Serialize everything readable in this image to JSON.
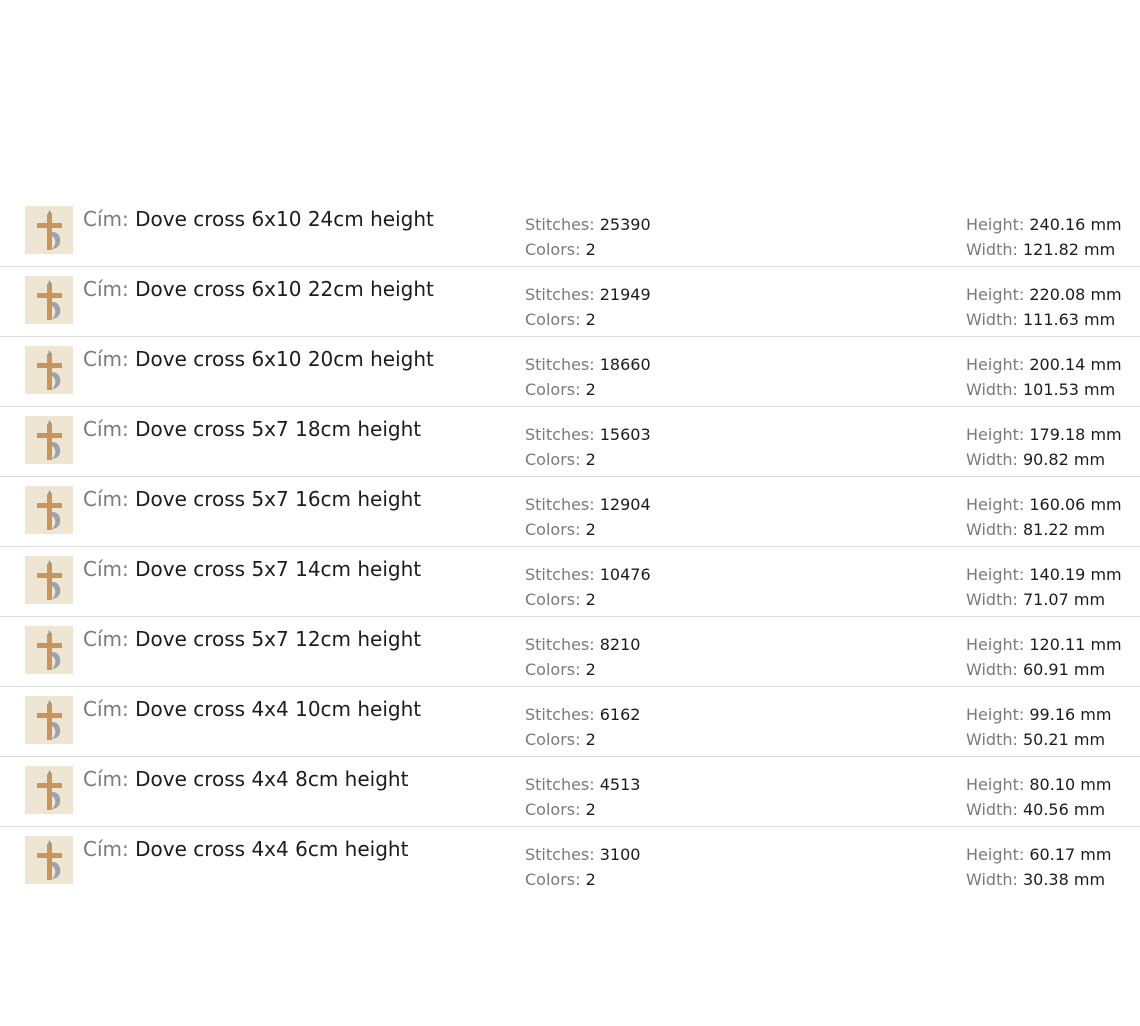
{
  "labels": {
    "title": "Cím:",
    "stitches": "Stitches:",
    "colors": "Colors:",
    "height": "Height:",
    "width": "Width:"
  },
  "icon": "cross-dove-icon",
  "files": [
    {
      "title": "Dove cross 6x10 24cm height",
      "stitches": "25390",
      "colors": "2",
      "height": "240.16 mm",
      "width": "121.82 mm"
    },
    {
      "title": "Dove cross 6x10 22cm height",
      "stitches": "21949",
      "colors": "2",
      "height": "220.08 mm",
      "width": "111.63 mm"
    },
    {
      "title": "Dove cross 6x10 20cm height",
      "stitches": "18660",
      "colors": "2",
      "height": "200.14 mm",
      "width": "101.53 mm"
    },
    {
      "title": "Dove cross 5x7 18cm height",
      "stitches": "15603",
      "colors": "2",
      "height": "179.18 mm",
      "width": "90.82 mm"
    },
    {
      "title": "Dove cross 5x7 16cm height",
      "stitches": "12904",
      "colors": "2",
      "height": "160.06 mm",
      "width": "81.22 mm"
    },
    {
      "title": "Dove cross 5x7 14cm height",
      "stitches": "10476",
      "colors": "2",
      "height": "140.19 mm",
      "width": "71.07 mm"
    },
    {
      "title": "Dove cross 5x7 12cm height",
      "stitches": "8210",
      "colors": "2",
      "height": "120.11 mm",
      "width": "60.91 mm"
    },
    {
      "title": "Dove cross 4x4 10cm height",
      "stitches": "6162",
      "colors": "2",
      "height": "99.16 mm",
      "width": "50.21 mm"
    },
    {
      "title": "Dove cross 4x4 8cm height",
      "stitches": "4513",
      "colors": "2",
      "height": "80.10 mm",
      "width": "40.56 mm"
    },
    {
      "title": "Dove cross 4x4 6cm height",
      "stitches": "3100",
      "colors": "2",
      "height": "60.17 mm",
      "width": "30.38 mm"
    }
  ]
}
